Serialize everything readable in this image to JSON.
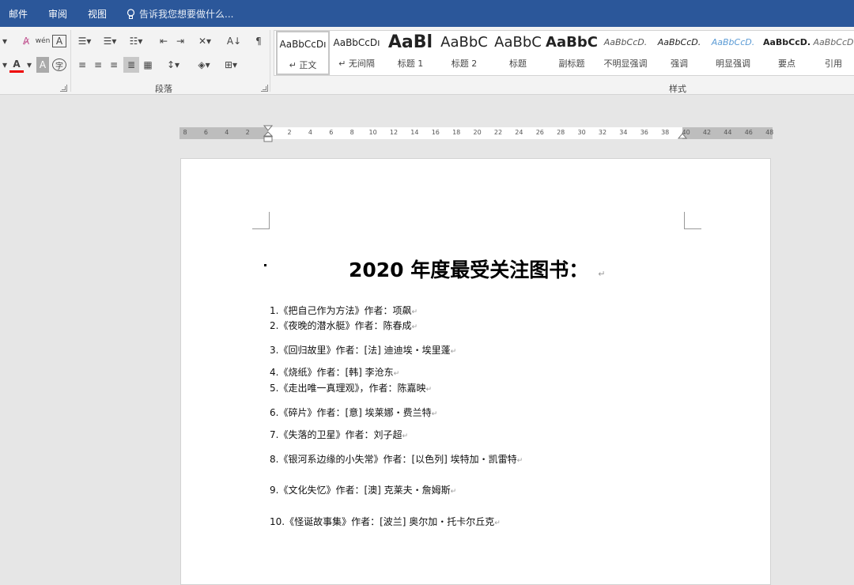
{
  "tabs": [
    "邮件",
    "审阅",
    "视图"
  ],
  "tell_me": "告诉我您想要做什么...",
  "ribbon": {
    "paragraph_group_label": "段落",
    "styles_group_label": "样式",
    "styles": [
      {
        "sample": "AaBbCcDı",
        "name": "↵ 正文"
      },
      {
        "sample": "AaBbCcDı",
        "name": "↵ 无间隔"
      },
      {
        "sample": "AaBl",
        "name": "标题 1"
      },
      {
        "sample": "AaBbC",
        "name": "标题 2"
      },
      {
        "sample": "AaBbC",
        "name": "标题"
      },
      {
        "sample": "AaBbC",
        "name": "副标题"
      },
      {
        "sample": "AaBbCcD.",
        "name": "不明显强调"
      },
      {
        "sample": "AaBbCcD.",
        "name": "强调"
      },
      {
        "sample": "AaBbCcD.",
        "name": "明显强调"
      },
      {
        "sample": "AaBbCcD.",
        "name": "要点"
      },
      {
        "sample": "AaBbCcD",
        "name": "引用"
      }
    ]
  },
  "ruler": [
    "8",
    "6",
    "4",
    "2",
    "2",
    "4",
    "6",
    "8",
    "10",
    "12",
    "14",
    "16",
    "18",
    "20",
    "22",
    "24",
    "26",
    "28",
    "30",
    "32",
    "34",
    "36",
    "38",
    "40",
    "42",
    "44",
    "46",
    "48"
  ],
  "document": {
    "title": "2020 年度最受关注图书：",
    "books": [
      {
        "num": "1.",
        "text": "《把自己作为方法》作者：项飙"
      },
      {
        "num": "2.",
        "text": "《夜晚的潜水艇》作者：陈春成"
      },
      {
        "num": "3.",
        "text": "《回归故里》作者：[法] 迪迪埃・埃里蓬"
      },
      {
        "num": "4.",
        "text": "《烧纸》作者：[韩] 李沧东"
      },
      {
        "num": "5.",
        "text": "《走出唯一真理观》，作者：陈嘉映"
      },
      {
        "num": "6.",
        "text": "《碎片》作者：[意] 埃莱娜・费兰特"
      },
      {
        "num": "7.",
        "text": "《失落的卫星》作者：刘子超"
      },
      {
        "num": "8.",
        "text": "《银河系边缘的小失常》作者：[以色列] 埃特加・凯雷特"
      },
      {
        "num": "9.",
        "text": "《文化失忆》作者：[澳] 克莱夫・詹姆斯"
      },
      {
        "num": "10.",
        "text": "《怪诞故事集》作者：[波兰] 奥尔加・托卡尔丘克"
      }
    ]
  }
}
